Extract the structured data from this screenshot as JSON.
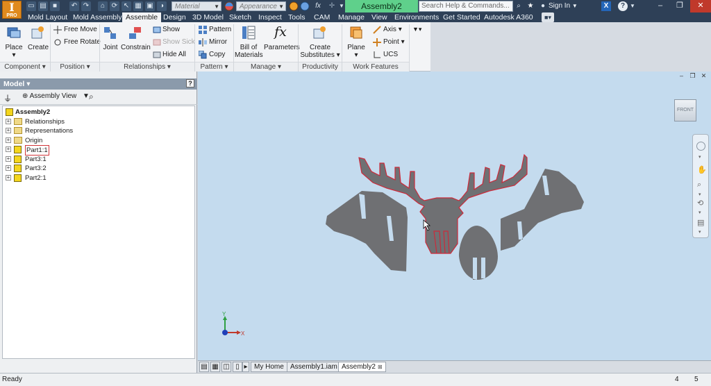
{
  "app": {
    "logo_text": "I",
    "logo_sub": "PRO",
    "document_title": "Assembly2"
  },
  "quick_access": {
    "material_placeholder": "Material",
    "appearance_placeholder": "Appearance",
    "fx_label": "fx"
  },
  "search": {
    "placeholder": "Search Help & Commands..."
  },
  "user": {
    "sign_in_label": "Sign In",
    "help_label": "?"
  },
  "menu_tabs": [
    "Mold Layout",
    "Mold Assembly",
    "Assemble",
    "Design",
    "3D Model",
    "Sketch",
    "Inspect",
    "Tools",
    "CAM",
    "Manage",
    "View",
    "Environments",
    "Get Started",
    "Autodesk A360"
  ],
  "active_tab": "Assemble",
  "ribbon": {
    "component": {
      "place": "Place",
      "create": "Create",
      "panel": "Component ▾"
    },
    "position": {
      "free_move": "Free Move",
      "free_rotate": "Free Rotate",
      "panel": "Position ▾"
    },
    "relationships": {
      "joint": "Joint",
      "constrain": "Constrain",
      "show": "Show",
      "show_sick": "Show Sick",
      "hide_all": "Hide All",
      "panel": "Relationships ▾"
    },
    "pattern": {
      "pattern": "Pattern",
      "mirror": "Mirror",
      "copy": "Copy",
      "panel": "Pattern ▾"
    },
    "manage": {
      "bom_line1": "Bill of",
      "bom_line2": "Materials",
      "parameters": "Parameters",
      "fx_glyph": "fx",
      "panel": "Manage ▾"
    },
    "productivity": {
      "create_line1": "Create",
      "create_line2": "Substitutes",
      "panel": "Productivity"
    },
    "work_features": {
      "plane": "Plane",
      "axis": "Axis",
      "point": "Point",
      "ucs": "UCS",
      "panel": "Work Features"
    }
  },
  "browser": {
    "title": "Model ▾",
    "help": "?",
    "view_label": "Assembly View",
    "root": "Assembly2",
    "items": [
      {
        "label": "Relationships",
        "type": "folder"
      },
      {
        "label": "Representations",
        "type": "folder"
      },
      {
        "label": "Origin",
        "type": "folder"
      },
      {
        "label": "Part1:1",
        "type": "part",
        "selected": true
      },
      {
        "label": "Part3:1",
        "type": "part"
      },
      {
        "label": "Part3:2",
        "type": "part"
      },
      {
        "label": "Part2:1",
        "type": "part"
      }
    ]
  },
  "viewport": {
    "viewcube_face": "FRONT",
    "triad": {
      "y": "Y",
      "x": "X"
    },
    "part_fill": "#6f7073",
    "highlight": "#cc2a3a"
  },
  "doc_tabs": [
    {
      "label": "My Home",
      "active": false,
      "closable": false
    },
    {
      "label": "Assembly1.iam",
      "active": false,
      "closable": false
    },
    {
      "label": "Assembly2",
      "active": true,
      "closable": true
    }
  ],
  "status": {
    "text": "Ready",
    "num1": "4",
    "num2": "5"
  }
}
